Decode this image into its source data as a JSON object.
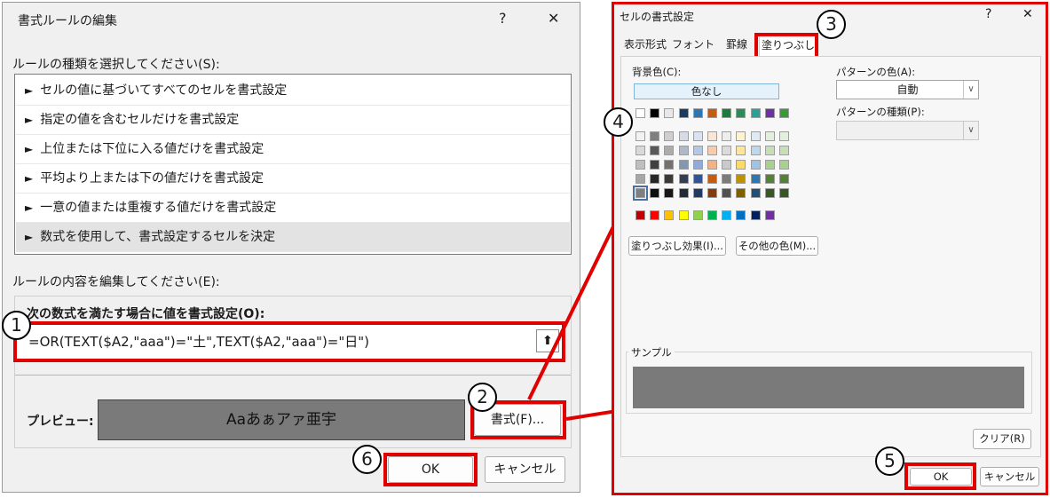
{
  "format_rule_dialog": {
    "title": "書式ルールの編集",
    "help": "?",
    "close": "✕",
    "rule_type_label": "ルールの種類を選択してください(S):",
    "rule_types": [
      "セルの値に基づいてすべてのセルを書式設定",
      "指定の値を含むセルだけを書式設定",
      "上位または下位に入る値だけを書式設定",
      "平均より上または下の値だけを書式設定",
      "一意の値または重複する値だけを書式設定",
      "数式を使用して、書式設定するセルを決定"
    ],
    "selected_rule_index": 5,
    "edit_label": "ルールの内容を編集してください(E):",
    "formula_label": "次の数式を満たす場合に値を書式設定(O):",
    "formula_value": "=OR(TEXT($A2,\"aaa\")=\"土\",TEXT($A2,\"aaa\")=\"日\")",
    "preview_label": "プレビュー:",
    "preview_text": "Aaあぁアァ亜宇",
    "format_button": "書式(F)...",
    "ok": "OK",
    "cancel": "キャンセル"
  },
  "cell_format_dialog": {
    "title": "セルの書式設定",
    "help": "?",
    "close": "✕",
    "tabs": [
      "表示形式",
      "フォント",
      "罫線",
      "塗りつぶし"
    ],
    "active_tab": "塗りつぶし",
    "bg_color_label": "背景色(C):",
    "no_color": "色なし",
    "pattern_color_label": "パターンの色(A):",
    "pattern_color_value": "自動",
    "pattern_type_label": "パターンの種類(P):",
    "pattern_type_value": "",
    "fill_effects_button": "塗りつぶし効果(I)...",
    "more_colors_button": "その他の色(M)...",
    "sample_label": "サンプル",
    "sample_color": "#7a7a7a",
    "clear_button": "クリア(R)",
    "ok": "OK",
    "cancel": "キャンセル",
    "theme_top_row": [
      "#ffffff",
      "#000000",
      "#e7e6e6",
      "#44546a",
      "#4472c4",
      "#ed7d31",
      "#a5a5a5",
      "#ffc000",
      "#5b9bd5",
      "#70ad47"
    ],
    "theme_top_row_alt": [
      "#ffffff",
      "#000000",
      "#e8e8e8",
      "#1f3a5f",
      "#2e75b6",
      "#c55a11",
      "#1e7a3c",
      "#2e8b57",
      "#2aa198",
      "#7030a0",
      "#3a9a3a"
    ],
    "theme_shades": [
      [
        "#f2f2f2",
        "#7f7f7f",
        "#d0cece",
        "#d6dce5",
        "#d9e2f3",
        "#fbe5d6",
        "#ededed",
        "#fff2cc",
        "#deebf7",
        "#e2f0d9",
        "#e2f0d9"
      ],
      [
        "#d9d9d9",
        "#595959",
        "#aeabab",
        "#adb9ca",
        "#b4c7e7",
        "#f8cbad",
        "#dbdbdb",
        "#ffe699",
        "#bdd7ee",
        "#c5e0b4",
        "#c5e0b4"
      ],
      [
        "#bfbfbf",
        "#404040",
        "#757171",
        "#8497b0",
        "#8faadc",
        "#f4b183",
        "#c9c9c9",
        "#ffd966",
        "#9dc3e6",
        "#a9d18e",
        "#a9d18e"
      ],
      [
        "#a6a6a6",
        "#262626",
        "#3b3838",
        "#333f50",
        "#2f5597",
        "#c55a11",
        "#7b7b7b",
        "#bf9000",
        "#2e75b6",
        "#548235",
        "#548235"
      ],
      [
        "#7f7f7f",
        "#0d0d0d",
        "#171616",
        "#222a35",
        "#1f3864",
        "#843c0c",
        "#525252",
        "#7f6000",
        "#1f4e79",
        "#385723",
        "#385723"
      ]
    ],
    "standard_colors": [
      "#c00000",
      "#ff0000",
      "#ffc000",
      "#ffff00",
      "#92d050",
      "#00b050",
      "#00b0f0",
      "#0070c0",
      "#002060",
      "#7030a0"
    ]
  },
  "annotations": {
    "badges": [
      "1",
      "2",
      "3",
      "4",
      "5",
      "6"
    ]
  }
}
